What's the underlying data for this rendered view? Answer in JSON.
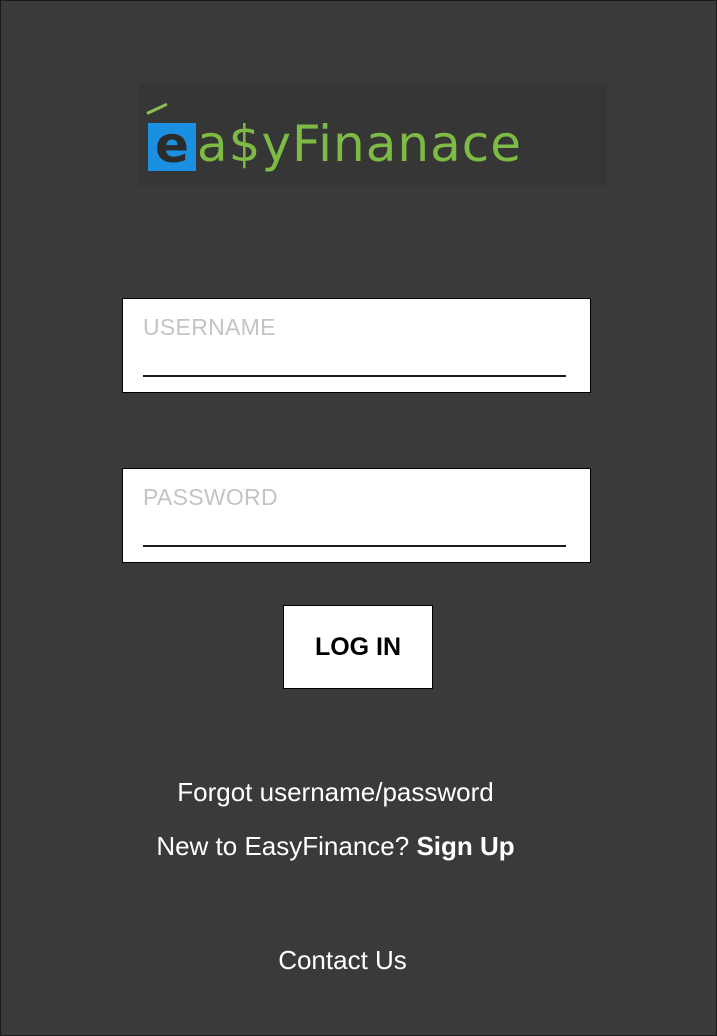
{
  "logo": {
    "first_letter": "e",
    "rest": "a$yFinanace",
    "colors": {
      "e_background": "#1b8fe0",
      "text": "#7dbb44"
    }
  },
  "form": {
    "username_placeholder": "USERNAME",
    "password_placeholder": "PASSWORD",
    "login_label": "LOG IN"
  },
  "links": {
    "forgot": "Forgot username/password",
    "new_prompt": "New to EasyFinance?",
    "signup": "Sign Up",
    "contact": "Contact Us"
  },
  "colors": {
    "background": "#3b393a",
    "field_background": "#ffffff",
    "placeholder": "#c4c4c4"
  }
}
